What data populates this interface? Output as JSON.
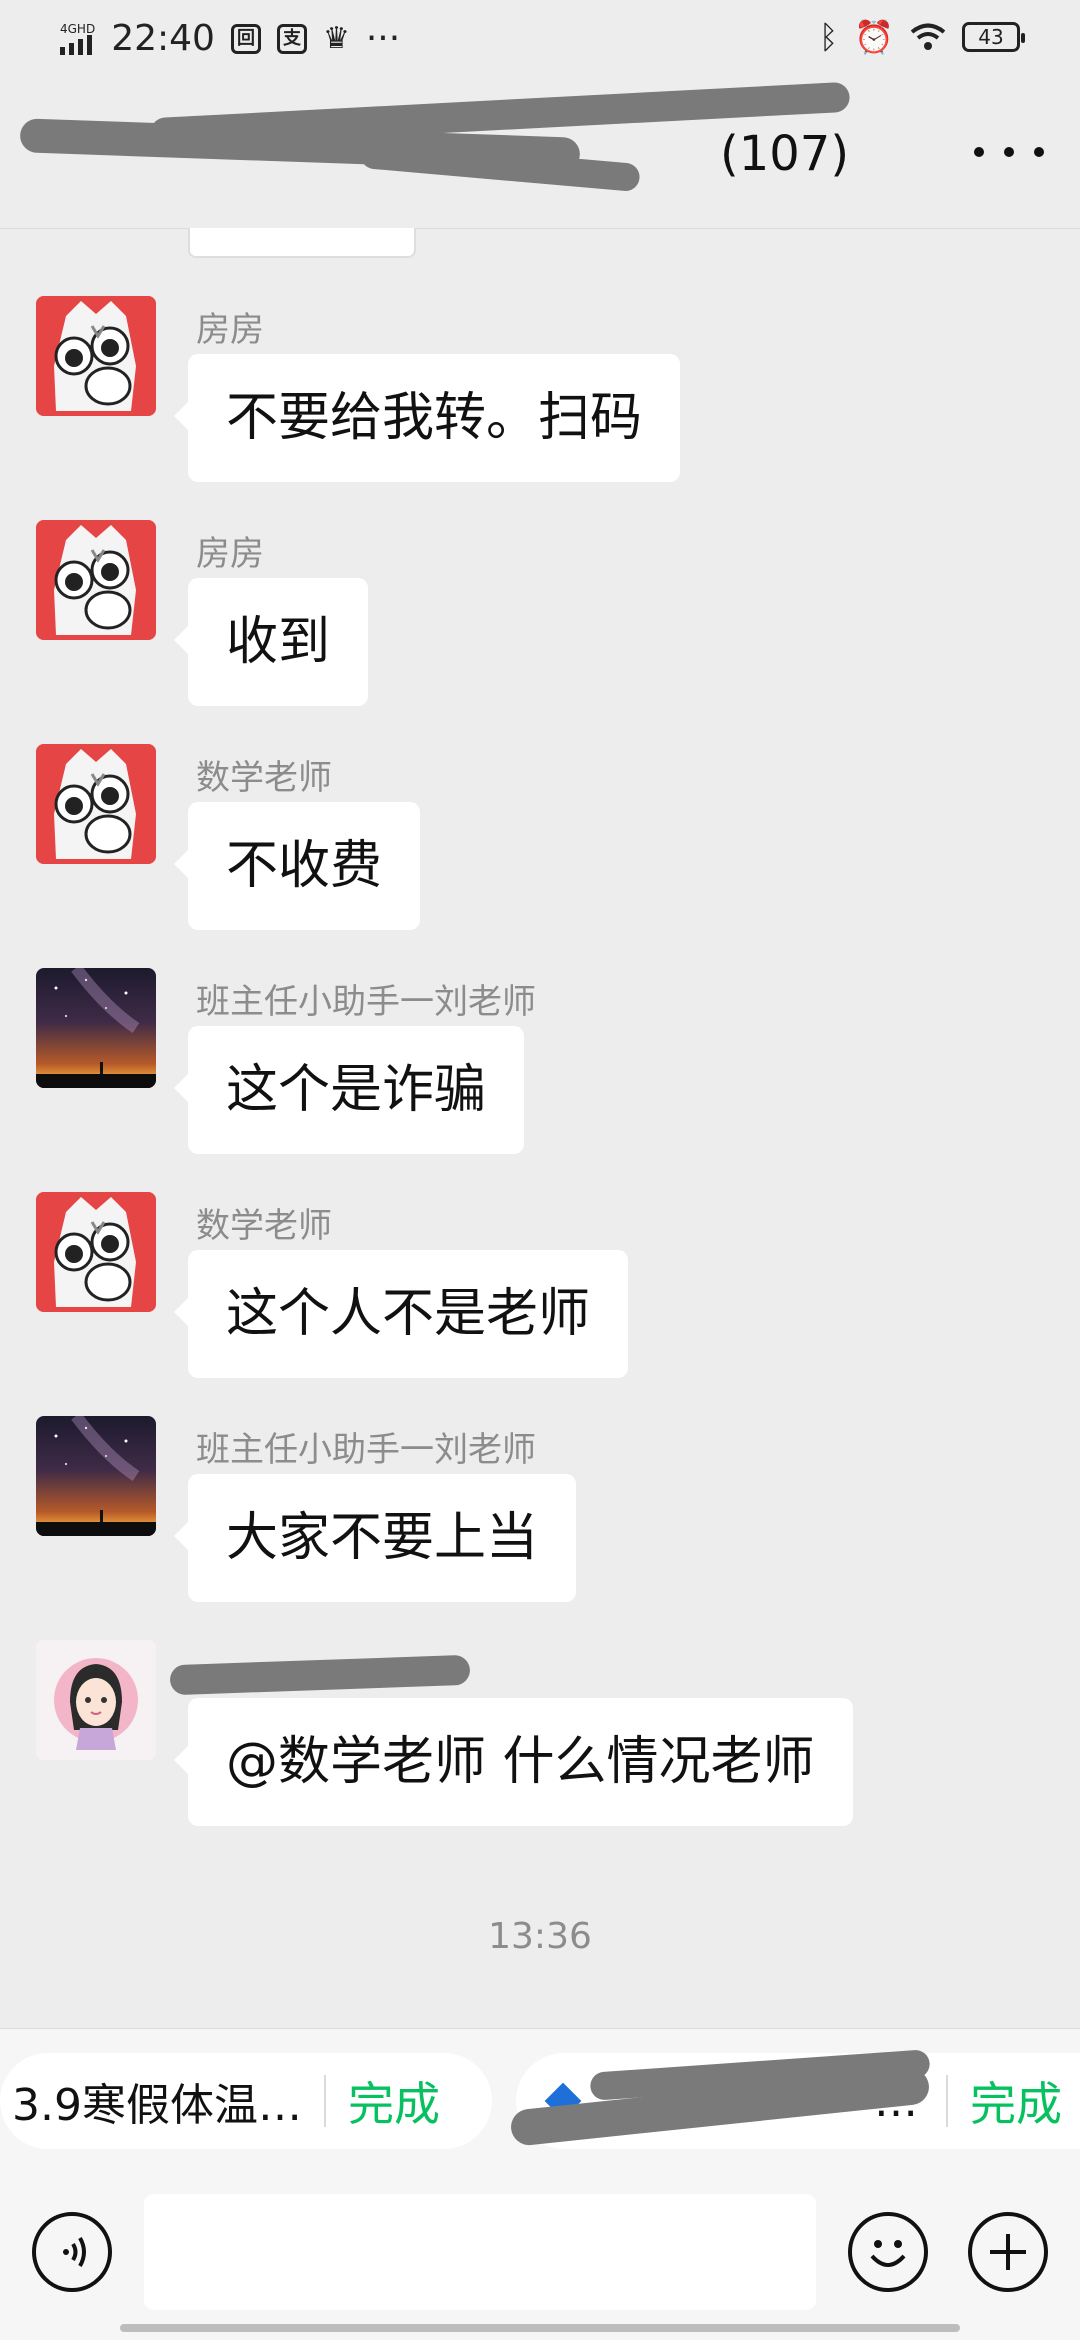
{
  "status_bar": {
    "network": "4GHD",
    "time": "22:40",
    "battery": "43",
    "more": "···"
  },
  "header": {
    "title": "(107)",
    "more_icon": "more-dots-icon"
  },
  "messages": [
    {
      "sender": "房房",
      "text": "不要给我转。扫码",
      "avatar": "cat"
    },
    {
      "sender": "房房",
      "text": "收到",
      "avatar": "cat"
    },
    {
      "sender": "数学老师",
      "text": "不收费",
      "avatar": "cat"
    },
    {
      "sender": "班主任小助手一刘老师",
      "text": "这个是诈骗",
      "avatar": "sky"
    },
    {
      "sender": "数学老师",
      "text": "这个人不是老师",
      "avatar": "cat"
    },
    {
      "sender": "班主任小助手一刘老师",
      "text": "大家不要上当",
      "avatar": "sky"
    },
    {
      "sender": "",
      "text": "@数学老师  什么情况老师",
      "avatar": "girl"
    }
  ],
  "timestamp": "13:36",
  "quick_replies": [
    {
      "text": "3.9寒假体温…",
      "action": "完成"
    },
    {
      "text": "…",
      "action": "完成"
    }
  ],
  "input_bar": {
    "voice_icon": "voice-icon",
    "emoji_icon": "emoji-icon",
    "plus_icon": "plus-icon",
    "input_value": ""
  },
  "colors": {
    "background": "#ededed",
    "bubble": "#ffffff",
    "accent_green": "#07c160",
    "sender_gray": "#8c8c8c"
  }
}
